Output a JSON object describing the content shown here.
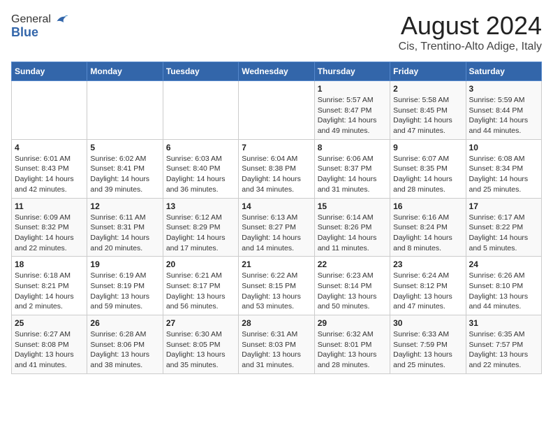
{
  "logo": {
    "general": "General",
    "blue": "Blue"
  },
  "header": {
    "month_year": "August 2024",
    "location": "Cis, Trentino-Alto Adige, Italy"
  },
  "days_of_week": [
    "Sunday",
    "Monday",
    "Tuesday",
    "Wednesday",
    "Thursday",
    "Friday",
    "Saturday"
  ],
  "weeks": [
    [
      {
        "day": "",
        "info": ""
      },
      {
        "day": "",
        "info": ""
      },
      {
        "day": "",
        "info": ""
      },
      {
        "day": "",
        "info": ""
      },
      {
        "day": "1",
        "info": "Sunrise: 5:57 AM\nSunset: 8:47 PM\nDaylight: 14 hours\nand 49 minutes."
      },
      {
        "day": "2",
        "info": "Sunrise: 5:58 AM\nSunset: 8:45 PM\nDaylight: 14 hours\nand 47 minutes."
      },
      {
        "day": "3",
        "info": "Sunrise: 5:59 AM\nSunset: 8:44 PM\nDaylight: 14 hours\nand 44 minutes."
      }
    ],
    [
      {
        "day": "4",
        "info": "Sunrise: 6:01 AM\nSunset: 8:43 PM\nDaylight: 14 hours\nand 42 minutes."
      },
      {
        "day": "5",
        "info": "Sunrise: 6:02 AM\nSunset: 8:41 PM\nDaylight: 14 hours\nand 39 minutes."
      },
      {
        "day": "6",
        "info": "Sunrise: 6:03 AM\nSunset: 8:40 PM\nDaylight: 14 hours\nand 36 minutes."
      },
      {
        "day": "7",
        "info": "Sunrise: 6:04 AM\nSunset: 8:38 PM\nDaylight: 14 hours\nand 34 minutes."
      },
      {
        "day": "8",
        "info": "Sunrise: 6:06 AM\nSunset: 8:37 PM\nDaylight: 14 hours\nand 31 minutes."
      },
      {
        "day": "9",
        "info": "Sunrise: 6:07 AM\nSunset: 8:35 PM\nDaylight: 14 hours\nand 28 minutes."
      },
      {
        "day": "10",
        "info": "Sunrise: 6:08 AM\nSunset: 8:34 PM\nDaylight: 14 hours\nand 25 minutes."
      }
    ],
    [
      {
        "day": "11",
        "info": "Sunrise: 6:09 AM\nSunset: 8:32 PM\nDaylight: 14 hours\nand 22 minutes."
      },
      {
        "day": "12",
        "info": "Sunrise: 6:11 AM\nSunset: 8:31 PM\nDaylight: 14 hours\nand 20 minutes."
      },
      {
        "day": "13",
        "info": "Sunrise: 6:12 AM\nSunset: 8:29 PM\nDaylight: 14 hours\nand 17 minutes."
      },
      {
        "day": "14",
        "info": "Sunrise: 6:13 AM\nSunset: 8:27 PM\nDaylight: 14 hours\nand 14 minutes."
      },
      {
        "day": "15",
        "info": "Sunrise: 6:14 AM\nSunset: 8:26 PM\nDaylight: 14 hours\nand 11 minutes."
      },
      {
        "day": "16",
        "info": "Sunrise: 6:16 AM\nSunset: 8:24 PM\nDaylight: 14 hours\nand 8 minutes."
      },
      {
        "day": "17",
        "info": "Sunrise: 6:17 AM\nSunset: 8:22 PM\nDaylight: 14 hours\nand 5 minutes."
      }
    ],
    [
      {
        "day": "18",
        "info": "Sunrise: 6:18 AM\nSunset: 8:21 PM\nDaylight: 14 hours\nand 2 minutes."
      },
      {
        "day": "19",
        "info": "Sunrise: 6:19 AM\nSunset: 8:19 PM\nDaylight: 13 hours\nand 59 minutes."
      },
      {
        "day": "20",
        "info": "Sunrise: 6:21 AM\nSunset: 8:17 PM\nDaylight: 13 hours\nand 56 minutes."
      },
      {
        "day": "21",
        "info": "Sunrise: 6:22 AM\nSunset: 8:15 PM\nDaylight: 13 hours\nand 53 minutes."
      },
      {
        "day": "22",
        "info": "Sunrise: 6:23 AM\nSunset: 8:14 PM\nDaylight: 13 hours\nand 50 minutes."
      },
      {
        "day": "23",
        "info": "Sunrise: 6:24 AM\nSunset: 8:12 PM\nDaylight: 13 hours\nand 47 minutes."
      },
      {
        "day": "24",
        "info": "Sunrise: 6:26 AM\nSunset: 8:10 PM\nDaylight: 13 hours\nand 44 minutes."
      }
    ],
    [
      {
        "day": "25",
        "info": "Sunrise: 6:27 AM\nSunset: 8:08 PM\nDaylight: 13 hours\nand 41 minutes."
      },
      {
        "day": "26",
        "info": "Sunrise: 6:28 AM\nSunset: 8:06 PM\nDaylight: 13 hours\nand 38 minutes."
      },
      {
        "day": "27",
        "info": "Sunrise: 6:30 AM\nSunset: 8:05 PM\nDaylight: 13 hours\nand 35 minutes."
      },
      {
        "day": "28",
        "info": "Sunrise: 6:31 AM\nSunset: 8:03 PM\nDaylight: 13 hours\nand 31 minutes."
      },
      {
        "day": "29",
        "info": "Sunrise: 6:32 AM\nSunset: 8:01 PM\nDaylight: 13 hours\nand 28 minutes."
      },
      {
        "day": "30",
        "info": "Sunrise: 6:33 AM\nSunset: 7:59 PM\nDaylight: 13 hours\nand 25 minutes."
      },
      {
        "day": "31",
        "info": "Sunrise: 6:35 AM\nSunset: 7:57 PM\nDaylight: 13 hours\nand 22 minutes."
      }
    ]
  ]
}
